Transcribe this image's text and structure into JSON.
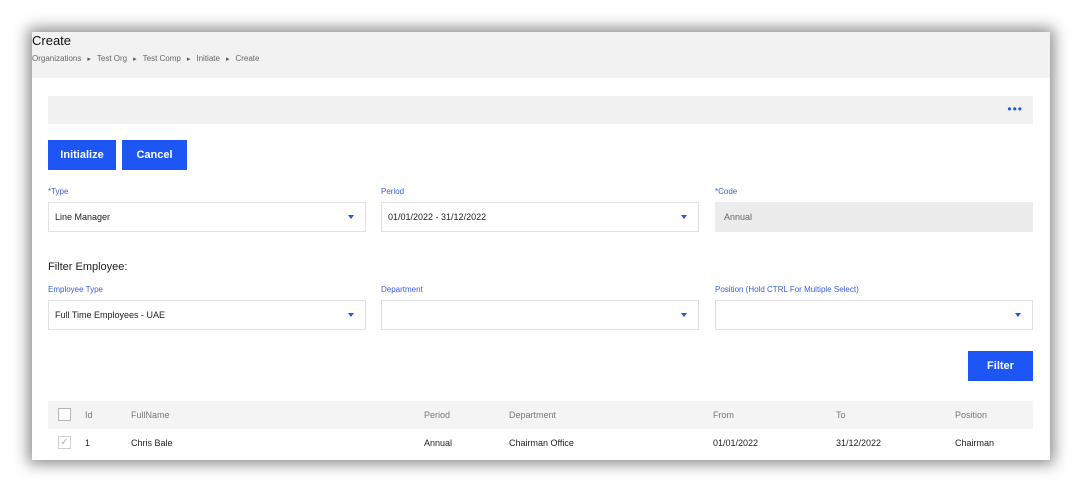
{
  "page": {
    "title": "Create",
    "breadcrumb": [
      "Organizations",
      "Test Org",
      "Test Comp",
      "Initiate",
      "Create"
    ]
  },
  "toolbar": {
    "more_icon": "ellipsis-icon"
  },
  "actions": {
    "initialize_label": "Initialize",
    "cancel_label": "Cancel",
    "filter_label": "Filter"
  },
  "form": {
    "type": {
      "label": "*Type",
      "value": "Line Manager"
    },
    "period": {
      "label": "Period",
      "value": "01/01/2022 - 31/12/2022"
    },
    "code": {
      "label": "*Code",
      "value": "Annual"
    }
  },
  "filter": {
    "title": "Filter Employee:",
    "employee_type": {
      "label": "Employee Type",
      "value": "Full Time Employees - UAE"
    },
    "department": {
      "label": "Department",
      "value": ""
    },
    "position": {
      "label": "Position (Hold CTRL For Multiple Select)",
      "value": ""
    }
  },
  "table": {
    "columns": [
      "Id",
      "FullName",
      "Period",
      "Department",
      "From",
      "To",
      "Position"
    ],
    "rows": [
      {
        "checked": true,
        "id": "1",
        "fullname": "Chris Bale",
        "period": "Annual",
        "department": "Chairman Office",
        "from": "01/01/2022",
        "to": "31/12/2022",
        "position": "Chairman"
      }
    ]
  },
  "colors": {
    "accent": "#1d56f5",
    "label": "#3a5fd9",
    "header_bg": "#f2f2f2"
  }
}
